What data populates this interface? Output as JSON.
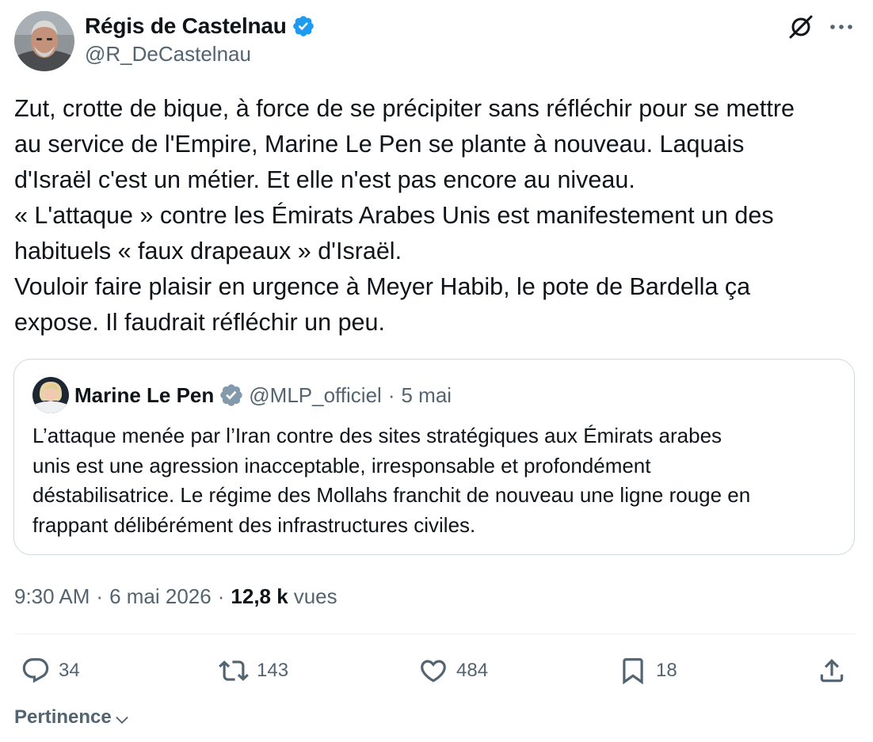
{
  "author": {
    "name": "Régis de Castelnau",
    "handle": "@R_DeCastelnau",
    "verified": true
  },
  "header_icons": [
    "grok-icon",
    "more-icon"
  ],
  "tweet": {
    "lines": [
      "Zut, crotte de bique, à force de se précipiter sans réfléchir pour se mettre",
      "au service de l'Empire, Marine Le Pen se plante à nouveau. Laquais",
      "d'Israël c'est un métier. Et elle n'est pas encore au niveau.",
      "« L'attaque » contre les Émirats Arabes Unis est manifestement un des",
      "habituels « faux drapeaux » d'Israël.",
      "Vouloir faire plaisir en urgence à Meyer Habib, le pote de Bardella ça",
      "expose. Il faudrait réfléchir un peu."
    ]
  },
  "quote": {
    "name": "Marine Le Pen",
    "handle": "@MLP_officiel",
    "separator": "·",
    "date": "5 mai",
    "verified": "gray",
    "lines": [
      "L’attaque menée par l’Iran contre des sites stratégiques aux Émirats arabes",
      "unis est une agression inacceptable, irresponsable et profondément",
      "déstabilisatrice. Le régime des Mollahs franchit de nouveau une ligne rouge en",
      "frappant délibérément des infrastructures civiles."
    ]
  },
  "meta": {
    "time": "9:30 AM",
    "separator": "·",
    "date": "6 mai 2026",
    "views_count": "12,8 k",
    "views_label": "vues"
  },
  "actions": {
    "replies": "34",
    "reposts": "143",
    "likes": "484",
    "bookmarks": "18"
  },
  "sort": {
    "label": "Pertinence"
  },
  "colors": {
    "text": "#0f1419",
    "secondary": "#536471",
    "verified_blue": "#1d9bf0",
    "verified_gray": "#829aab",
    "border": "#cfd9de"
  }
}
